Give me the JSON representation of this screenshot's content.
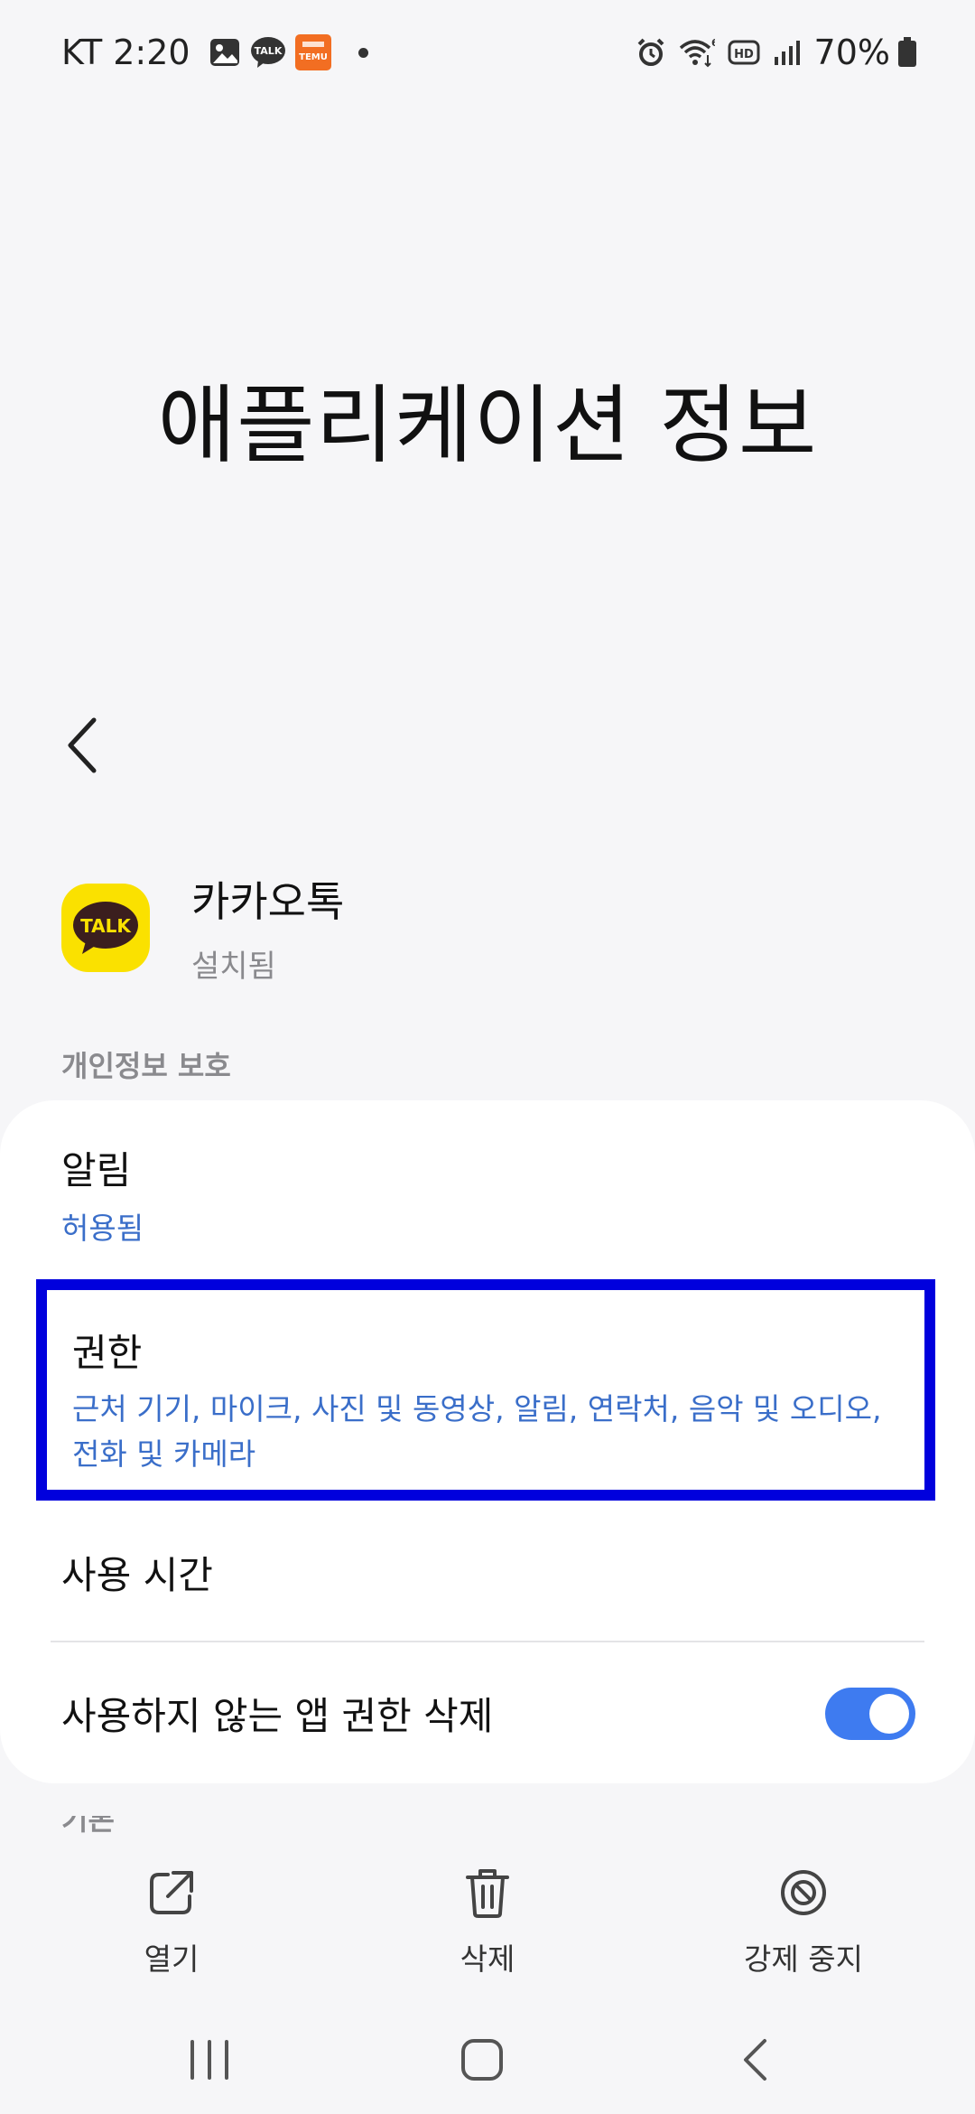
{
  "status_bar": {
    "carrier_time": "KT 2:20",
    "battery": "70%",
    "left_icons": [
      "gallery-icon",
      "kakaotalk-notification-icon",
      "temu-notification-icon"
    ],
    "right_icons": [
      "alarm-icon",
      "wifi-icon",
      "hd-icon",
      "signal-icon",
      "battery-icon"
    ],
    "talk_badge": "TALK",
    "temu_badge": "TEMU",
    "wifi_badge": "6",
    "hd_badge": "HD"
  },
  "page": {
    "title": "애플리케이션 정보"
  },
  "app": {
    "name": "카카오톡",
    "status": "설치됨",
    "icon_text": "TALK",
    "icon_color": "#fae100"
  },
  "privacy": {
    "section_title": "개인정보 보호",
    "notifications": {
      "title": "알림",
      "value": "허용됨"
    },
    "permissions": {
      "title": "권한",
      "value": "근처 기기, 마이크, 사진 및 동영상, 알림, 연락처, 음악 및 오디오, 전화 및 카메라"
    },
    "usage_time": {
      "title": "사용 시간"
    },
    "remove_unused": {
      "title": "사용하지 않는 앱 권한 삭제",
      "enabled": true
    }
  },
  "next_section_cut": "기본",
  "actions": {
    "open": "열기",
    "delete": "삭제",
    "force_stop": "강제 중지"
  },
  "colors": {
    "accent": "#3e7bf0",
    "link": "#3a6ec9",
    "highlight_border": "#0000dd"
  }
}
